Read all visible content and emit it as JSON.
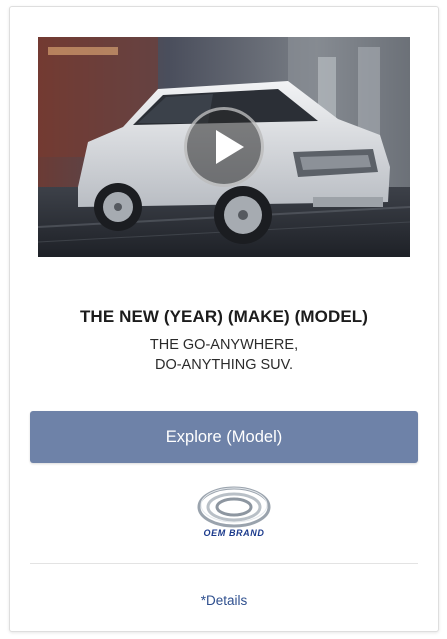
{
  "card": {
    "headline": "THE NEW (YEAR) (MAKE) (MODEL)",
    "tagline_line1": "THE GO-ANYWHERE,",
    "tagline_line2": "DO-ANYTHING SUV.",
    "cta_label": "Explore (Model)",
    "brand_text": "OEM BRAND",
    "details_label": "*Details"
  },
  "video": {
    "thumbnail": "white-compact-suv-city-street",
    "overlay_icon": "play-icon"
  },
  "colors": {
    "cta_background": "#6e82a8",
    "brand_blue": "#1b3a8c",
    "link_blue": "#2e4f8e"
  }
}
